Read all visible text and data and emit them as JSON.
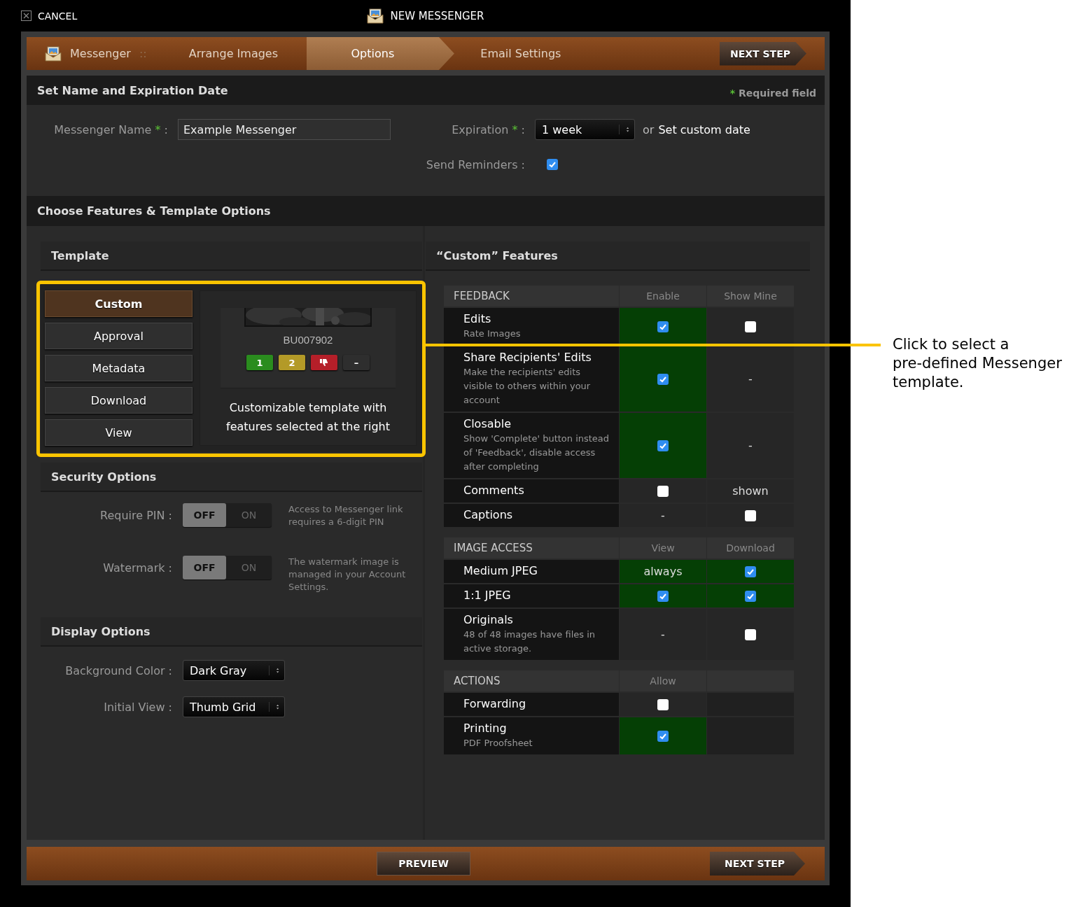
{
  "top_bar": {
    "cancel": "CANCEL",
    "title": "NEW MESSENGER"
  },
  "steps": {
    "items": [
      {
        "label": "Messenger",
        "selected": false
      },
      {
        "label": "Arrange Images",
        "selected": false
      },
      {
        "label": "Options",
        "selected": true
      },
      {
        "label": "Email Settings",
        "selected": false
      }
    ],
    "separator": "::",
    "next_button": "NEXT STEP"
  },
  "name_section": {
    "title": "Set Name and Expiration Date",
    "required_mark": "*",
    "required_note": "Required field",
    "label_end": ":",
    "fields": [
      {
        "kind": "text",
        "label": "Messenger Name",
        "required": true,
        "value": "Example Messenger"
      },
      {
        "kind": "select",
        "label": "Expiration",
        "required": true,
        "value": "1 week",
        "joiner": "or",
        "link": "Set custom date"
      },
      {
        "kind": "checkbox",
        "label": "Send Reminders",
        "required": false,
        "checked": true
      }
    ]
  },
  "features_title": "Choose Features & Template Options",
  "template": {
    "title": "Template",
    "options": [
      {
        "label": "Custom",
        "selected": true
      },
      {
        "label": "Approval",
        "selected": false
      },
      {
        "label": "Metadata",
        "selected": false
      },
      {
        "label": "Download",
        "selected": false
      },
      {
        "label": "View",
        "selected": false
      }
    ],
    "preview": {
      "code": "BU007902",
      "badges": [
        {
          "kind": "text",
          "text": "1",
          "color": "#2a8c1e"
        },
        {
          "kind": "text",
          "text": "2",
          "color": "#b39a27"
        },
        {
          "kind": "thumbs-down",
          "color": "#b51f29"
        },
        {
          "kind": "text",
          "text": "–",
          "color": "#2e2e2e"
        }
      ]
    },
    "description": "Customizable template with features selected at the right"
  },
  "security": {
    "title": "Security Options",
    "toggles": [
      {
        "label": "Require PIN :",
        "off_text": "OFF",
        "on_text": "ON",
        "on": false,
        "note": "Access to Messenger link requires a 6-digit PIN"
      },
      {
        "label": "Watermark :",
        "off_text": "OFF",
        "on_text": "ON",
        "on": false,
        "note": "The watermark image is managed in your Account Settings."
      }
    ]
  },
  "display": {
    "title": "Display Options",
    "selects": [
      {
        "label": "Background Color :",
        "value": "Dark Gray"
      },
      {
        "label": "Initial View :",
        "value": "Thumb Grid"
      }
    ]
  },
  "features": {
    "title": "“Custom” Features",
    "groups": [
      {
        "title": "FEEDBACK",
        "columns": [
          "Enable",
          "Show Mine"
        ],
        "rows": [
          {
            "name": "Edits",
            "description": "Rate Images",
            "cells": [
              {
                "kind": "checkbox",
                "checked": true
              },
              {
                "kind": "checkbox",
                "checked": false
              }
            ]
          },
          {
            "name": "Share Recipients' Edits",
            "description": "Make the recipients' edits visible to others within your account",
            "cells": [
              {
                "kind": "checkbox",
                "checked": true
              },
              {
                "kind": "text",
                "text": "-",
                "on": false
              }
            ]
          },
          {
            "name": "Closable",
            "description": "Show 'Complete' button instead of 'Feedback', disable access after completing",
            "cells": [
              {
                "kind": "checkbox",
                "checked": true
              },
              {
                "kind": "text",
                "text": "-",
                "on": false
              }
            ]
          },
          {
            "name": "Comments",
            "cells": [
              {
                "kind": "checkbox",
                "checked": false
              },
              {
                "kind": "text",
                "text": "shown",
                "on": false
              }
            ]
          },
          {
            "name": "Captions",
            "cells": [
              {
                "kind": "text",
                "text": "-",
                "on": false
              },
              {
                "kind": "checkbox",
                "checked": false
              }
            ]
          }
        ]
      },
      {
        "title": "IMAGE ACCESS",
        "columns": [
          "View",
          "Download"
        ],
        "rows": [
          {
            "name": "Medium JPEG",
            "cells": [
              {
                "kind": "text",
                "text": "always",
                "on": true
              },
              {
                "kind": "checkbox",
                "checked": true
              }
            ]
          },
          {
            "name": "1:1 JPEG",
            "cells": [
              {
                "kind": "checkbox",
                "checked": true
              },
              {
                "kind": "checkbox",
                "checked": true
              }
            ]
          },
          {
            "name": "Originals",
            "description": "48 of 48 images have files in active storage.",
            "cells": [
              {
                "kind": "text",
                "text": "-",
                "on": false
              },
              {
                "kind": "checkbox",
                "checked": false
              }
            ]
          }
        ]
      },
      {
        "title": "ACTIONS",
        "columns": [
          "Allow"
        ],
        "rows": [
          {
            "name": "Forwarding",
            "cells": [
              {
                "kind": "checkbox",
                "checked": false
              }
            ]
          },
          {
            "name": "Printing",
            "description": "PDF Proofsheet",
            "cells": [
              {
                "kind": "checkbox",
                "checked": true
              }
            ]
          }
        ]
      }
    ]
  },
  "bottom_bar": {
    "preview": "PREVIEW",
    "next_button": "NEXT STEP"
  },
  "callout": {
    "text": "Click to select a pre-defined Messenger template."
  }
}
